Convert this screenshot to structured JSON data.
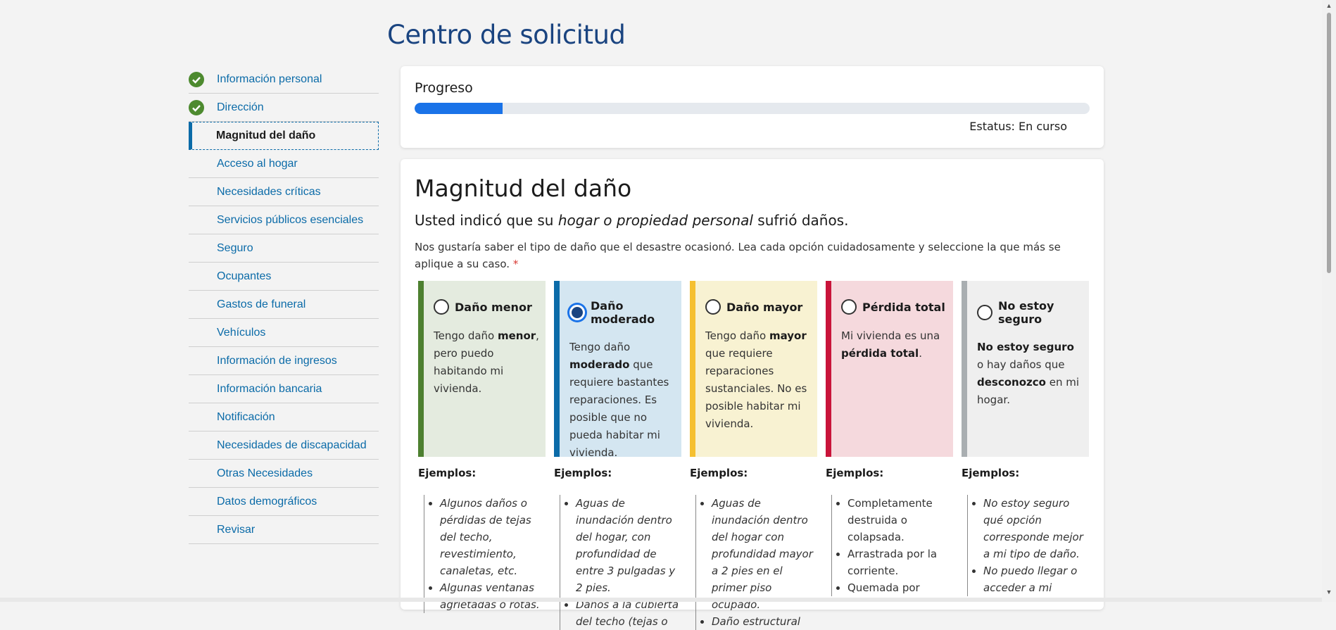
{
  "page": {
    "title": "Centro de solicitud"
  },
  "sidebar": {
    "items": [
      {
        "label": "Información personal",
        "completed": true
      },
      {
        "label": "Dirección",
        "completed": true
      },
      {
        "label": "Magnitud del daño",
        "current": true
      },
      {
        "label": "Acceso al hogar"
      },
      {
        "label": "Necesidades críticas"
      },
      {
        "label": "Servicios públicos esenciales"
      },
      {
        "label": "Seguro"
      },
      {
        "label": "Ocupantes"
      },
      {
        "label": "Gastos de funeral"
      },
      {
        "label": "Vehículos"
      },
      {
        "label": "Información de ingresos"
      },
      {
        "label": "Información bancaria"
      },
      {
        "label": "Notificación"
      },
      {
        "label": "Necesidades de discapacidad"
      },
      {
        "label": "Otras Necesidades"
      },
      {
        "label": "Datos demográficos"
      },
      {
        "label": "Revisar"
      }
    ]
  },
  "progress": {
    "title": "Progreso",
    "fraction": 0.13,
    "status": "Estatus: En curso"
  },
  "section": {
    "heading": "Magnitud del daño",
    "subheading_pre": "Usted indicó que su ",
    "subheading_em": "hogar o propiedad personal",
    "subheading_post": " sufrió daños.",
    "instructions": "Nos gustaría saber el tipo de daño que el desastre ocasionó. Lea cada opción cuidadosamente y seleccione la que más se aplique a su caso.",
    "required_mark": "*",
    "examples_title": "Ejemplos:"
  },
  "options": [
    {
      "label": "Daño menor",
      "selected": false,
      "color": "#4d8030",
      "bg": "#e4ebdf",
      "desc": [
        "Tengo daño ",
        {
          "b": "menor"
        },
        ", pero puedo habitando mi vivienda."
      ],
      "examples_italic": true,
      "examples": [
        "Algunos daños o pérdidas de tejas del techo, revestimiento, canaletas, etc.",
        "Algunas ventanas agrietadas o rotas."
      ]
    },
    {
      "label": "Daño moderado",
      "selected": true,
      "color": "#0b6ba8",
      "bg": "#d4e6f1",
      "desc": [
        "Tengo daño ",
        {
          "b": "moderado"
        },
        " que requiere bastantes reparaciones. Es posible que no pueda habitar mi vivienda."
      ],
      "examples_italic": true,
      "examples": [
        "Aguas de inundación dentro del hogar, con profundidad de entre 3 pulgadas y 2 pies.",
        "Daños a la cubierta del techo (tejas o"
      ]
    },
    {
      "label": "Daño mayor",
      "selected": false,
      "color": "#f5c031",
      "bg": "#f8f2d2",
      "desc": [
        "Tengo daño ",
        {
          "b": "mayor"
        },
        " que requiere reparaciones sustanciales. No es posible habitar mi vivienda."
      ],
      "examples_italic": true,
      "examples": [
        "Aguas de inundación dentro del hogar con profundidad mayor a 2 pies en el primer piso ocupado.",
        "Daño estructural"
      ]
    },
    {
      "label": "Pérdida total",
      "selected": false,
      "color": "#c9143a",
      "bg": "#f5d9dd",
      "desc": [
        "Mi vivienda es una ",
        {
          "b": "pérdida total"
        },
        "."
      ],
      "examples_italic": false,
      "examples": [
        "Completamente destruida o colapsada.",
        "Arrastrada por la corriente.",
        "Quemada por"
      ]
    },
    {
      "label": "No estoy seguro",
      "selected": false,
      "color": "#a9aeb1",
      "bg": "#efefef",
      "desc": [
        {
          "b": "No estoy seguro"
        },
        " o hay daños que ",
        {
          "b": "desconozco"
        },
        " en mi hogar."
      ],
      "examples_italic": true,
      "examples": [
        "No estoy seguro qué opción corresponde mejor a mi tipo de daño.",
        "No puedo llegar o acceder a mi"
      ]
    }
  ]
}
